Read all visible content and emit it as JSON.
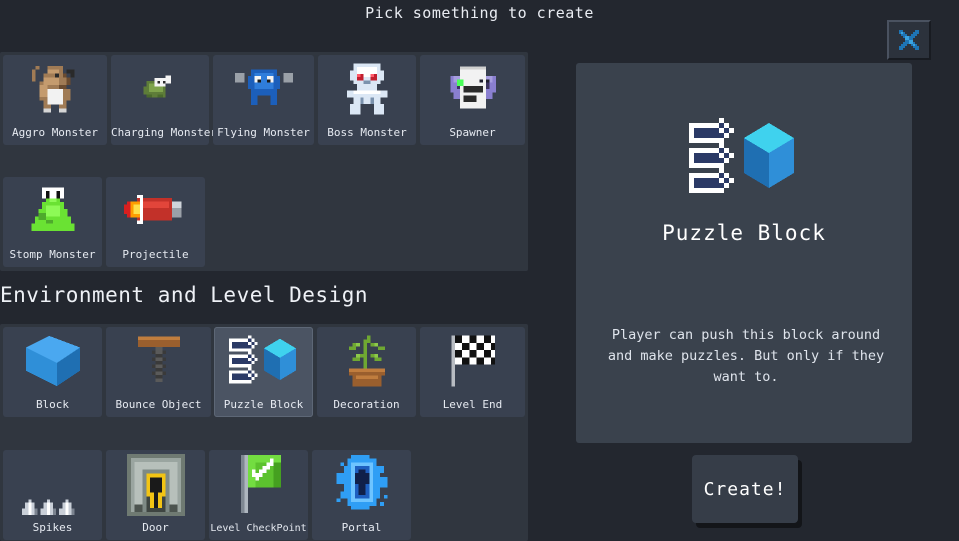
{
  "window": {
    "title": "Pick something to create",
    "close_icon": "close-x-icon",
    "background_color": "#23272f",
    "panel_color": "#30363f",
    "cell_color": "#394150",
    "cell_selected_color": "#4b5463",
    "detail_panel_color": "#3a424d",
    "accent_color": "#2f8fd8"
  },
  "sections": [
    {
      "id": "monsters",
      "header": "",
      "items": [
        {
          "label": "Aggro Monster",
          "icon": "aggro-monster-icon",
          "selected": false
        },
        {
          "label": "Charging Monster",
          "icon": "charging-monster-icon",
          "selected": false
        },
        {
          "label": "Flying Monster",
          "icon": "flying-monster-icon",
          "selected": false
        },
        {
          "label": "Boss Monster",
          "icon": "boss-monster-icon",
          "selected": false
        },
        {
          "label": "Spawner",
          "icon": "spawner-icon",
          "selected": false
        },
        {
          "label": "Stomp Monster",
          "icon": "stomp-monster-icon",
          "selected": false
        },
        {
          "label": "Projectile",
          "icon": "projectile-icon",
          "selected": false
        }
      ]
    },
    {
      "id": "environment",
      "header": "Environment and Level Design",
      "items": [
        {
          "label": "Block",
          "icon": "block-icon",
          "selected": false
        },
        {
          "label": "Bounce Object",
          "icon": "bounce-object-icon",
          "selected": false
        },
        {
          "label": "Puzzle Block",
          "icon": "puzzle-block-icon",
          "selected": true
        },
        {
          "label": "Decoration",
          "icon": "decoration-icon",
          "selected": false
        },
        {
          "label": "Level End",
          "icon": "level-end-icon",
          "selected": false
        },
        {
          "label": "Spikes",
          "icon": "spikes-icon",
          "selected": false
        },
        {
          "label": "Door",
          "icon": "door-icon",
          "selected": false
        },
        {
          "label": "Level CheckPoint",
          "icon": "level-checkpoint-icon",
          "selected": false
        },
        {
          "label": "Portal",
          "icon": "portal-icon",
          "selected": false
        }
      ]
    }
  ],
  "detail": {
    "icon": "puzzle-block-icon",
    "title": "Puzzle Block",
    "description": "Player can push this block around and make puzzles. But only if they want to."
  },
  "create_button": {
    "label": "Create!"
  }
}
